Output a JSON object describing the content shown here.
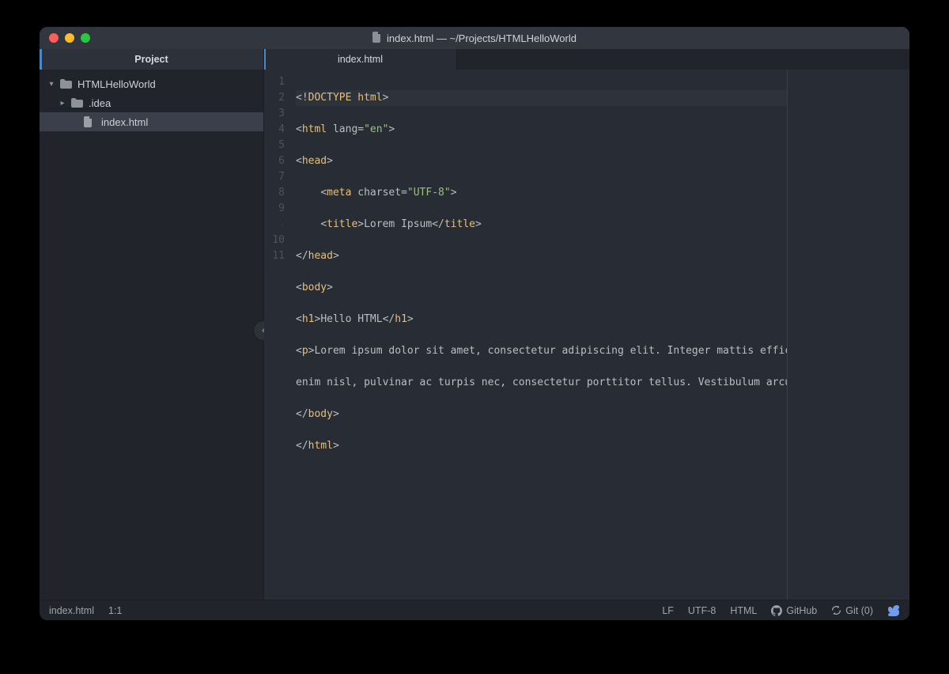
{
  "titlebar": {
    "title": "index.html — ~/Projects/HTMLHelloWorld"
  },
  "sidebar": {
    "header": "Project",
    "tree": {
      "root": {
        "name": "HTMLHelloWorld",
        "expanded": true
      },
      "idea": {
        "name": ".idea",
        "expanded": false
      },
      "file": {
        "name": "index.html"
      }
    }
  },
  "tabs": {
    "active_label": "index.html"
  },
  "gutter_labels": {
    "l1": "1",
    "l2": "2",
    "l3": "3",
    "l4": "4",
    "l5": "5",
    "l6": "6",
    "l7": "7",
    "l8": "8",
    "l9": "9",
    "lc": "·",
    "l10": "10",
    "l11": "11"
  },
  "code": {
    "line1": {
      "p0": "<!",
      "t": "DOCTYPE html",
      "p1": ">"
    },
    "line2": {
      "p0": "<",
      "t": "html",
      "a": " lang=",
      "v": "\"en\"",
      "p1": ">"
    },
    "line3": {
      "p0": "<",
      "t": "head",
      "p1": ">"
    },
    "line4": {
      "pad": "    ",
      "p0": "<",
      "t": "meta",
      "a": " charset=",
      "v": "\"UTF-8\"",
      "p1": ">"
    },
    "line5": {
      "pad": "    ",
      "p0": "<",
      "t0": "title",
      "m": ">",
      "text": "Lorem Ipsum",
      "c0": "</",
      "t1": "title",
      "p1": ">"
    },
    "line6": {
      "p0": "</",
      "t": "head",
      "p1": ">"
    },
    "line7": {
      "p0": "<",
      "t": "body",
      "p1": ">"
    },
    "line8": {
      "p0": "<",
      "t0": "h1",
      "m": ">",
      "text": "Hello HTML",
      "c0": "</",
      "t1": "h1",
      "p1": ">"
    },
    "line9": {
      "p0": "<",
      "t": "p",
      "m": ">",
      "text": "Lorem ipsum dolor sit amet, consectetur adipiscing elit. Integer mattis efficitur urna, quis l"
    },
    "line9b": {
      "text": "enim nisl, pulvinar ac turpis nec, consectetur porttitor tellus. Vestibulum arcu enim, tempus eu "
    },
    "line10": {
      "p0": "</",
      "t": "body",
      "p1": ">"
    },
    "line11": {
      "p0": "</",
      "t": "html",
      "p1": ">"
    }
  },
  "statusbar": {
    "file": "index.html",
    "pos": "1:1",
    "line_sep": "LF",
    "encoding": "UTF-8",
    "language": "HTML",
    "github": "GitHub",
    "git": "Git (0)"
  }
}
